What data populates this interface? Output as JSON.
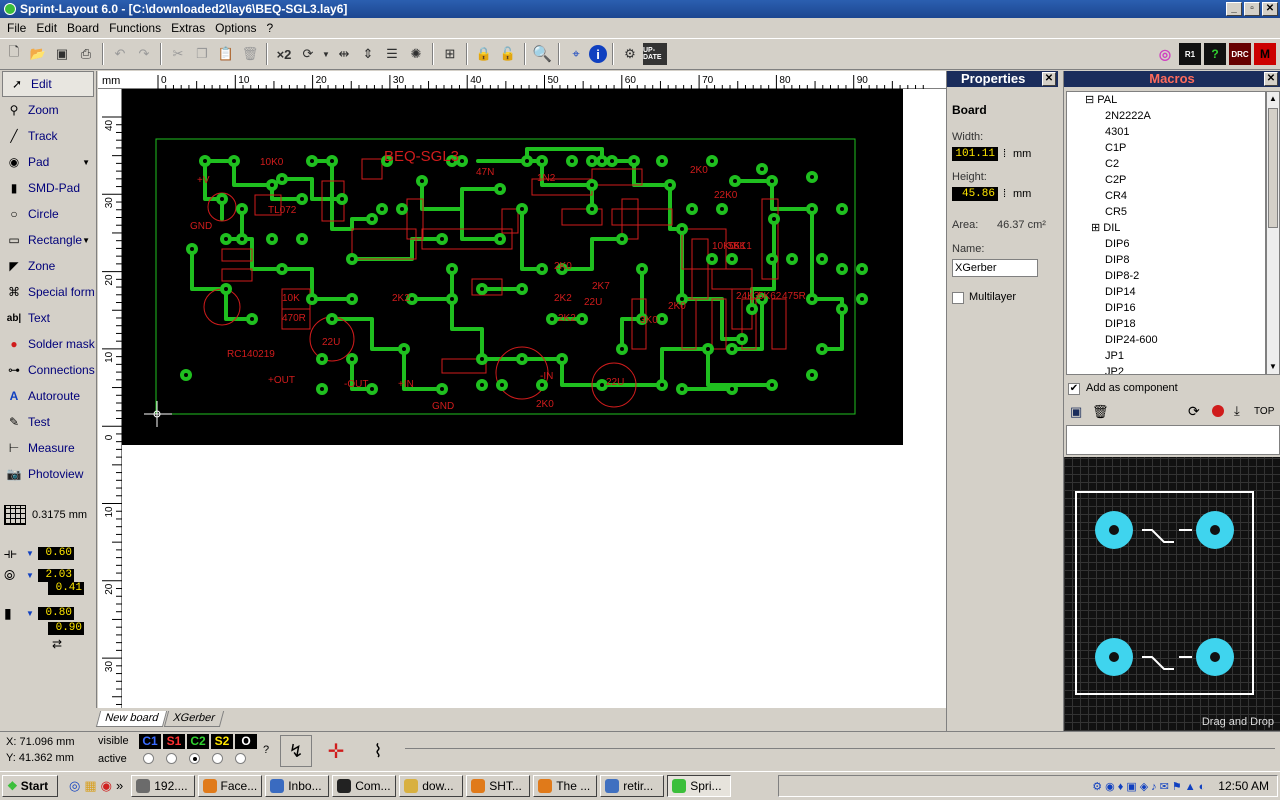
{
  "window": {
    "title": "Sprint-Layout 6.0 - [C:\\downloaded2\\lay6\\BEQ-SGL3.lay6]",
    "controls": [
      "_",
      "▫",
      "✕"
    ]
  },
  "menu": [
    "File",
    "Edit",
    "Board",
    "Functions",
    "Extras",
    "Options",
    "?"
  ],
  "toolbar": {
    "mult_label": "×2",
    "update_label": "UP-DATE",
    "right_icons": [
      "R1",
      "?",
      "DRC",
      "M"
    ]
  },
  "tools": [
    {
      "label": "Edit",
      "icon": "pointer-icon"
    },
    {
      "label": "Zoom",
      "icon": "magnifier-icon"
    },
    {
      "label": "Track",
      "icon": "track-icon"
    },
    {
      "label": "Pad",
      "icon": "pad-icon"
    },
    {
      "label": "SMD-Pad",
      "icon": "smd-pad-icon"
    },
    {
      "label": "Circle",
      "icon": "circle-icon"
    },
    {
      "label": "Rectangle",
      "icon": "rectangle-icon"
    },
    {
      "label": "Zone",
      "icon": "zone-icon"
    },
    {
      "label": "Special form",
      "icon": "special-form-icon"
    },
    {
      "label": "Text",
      "icon": "text-icon"
    },
    {
      "label": "Solder mask",
      "icon": "solder-mask-icon"
    },
    {
      "label": "Connections",
      "icon": "connections-icon"
    },
    {
      "label": "Autoroute",
      "icon": "autoroute-icon"
    },
    {
      "label": "Test",
      "icon": "test-icon"
    },
    {
      "label": "Measure",
      "icon": "measure-icon"
    },
    {
      "label": "Photoview",
      "icon": "photoview-icon"
    }
  ],
  "grid": {
    "value": "0.3175 mm"
  },
  "track_width": "0.60",
  "pad_outer": "2.03",
  "pad_inner": "0.41",
  "smd_w": "0.80",
  "smd_h": "0.90",
  "ruler": {
    "unit": "mm",
    "top_ticks": [
      "0",
      "10",
      "20",
      "30",
      "40",
      "50",
      "60",
      "70",
      "80",
      "90"
    ],
    "left_ticks": [
      "40",
      "30",
      "20",
      "10",
      "0",
      "10",
      "20",
      "30"
    ]
  },
  "board": {
    "silkscreen_texts": [
      "10K0",
      "TL072",
      "BEQ-SGL3",
      "47N",
      "1N2",
      "2K0",
      "22K0",
      "+V",
      "GND",
      "RC140219",
      "+OUT",
      "-OUT",
      "+IN",
      "GND",
      "-IN",
      "2K0",
      "10K",
      "470R",
      "22U",
      "22U",
      "2K2",
      "5K1",
      "24K3",
      "5K62",
      "475R",
      "10K0",
      "5K1",
      "2K0",
      "2K7",
      "2K2",
      "2K2",
      "3K0",
      "2K0",
      "22U"
    ]
  },
  "tabs": [
    "New board",
    "XGerber"
  ],
  "properties": {
    "title": "Properties",
    "section": "Board",
    "width_label": "Width:",
    "width_value": "101.11",
    "height_label": "Height:",
    "height_value": "45.86",
    "unit": "mm",
    "area_label": "Area:",
    "area_value": "46.37 cm²",
    "name_label": "Name:",
    "name_value": "XGerber",
    "multilayer_label": "Multilayer"
  },
  "macros": {
    "title": "Macros",
    "root": "PAL",
    "items": [
      "2N2222A",
      "4301",
      "C1P",
      "C2",
      "C2P",
      "CR4",
      "CR5",
      "DIL",
      "DIP6",
      "DIP8",
      "DIP8-2",
      "DIP14",
      "DIP16",
      "DIP18",
      "DIP24-600",
      "JP1",
      "JP2"
    ],
    "add_as_component": "Add as component",
    "top_label": "TOP",
    "drag_drop": "Drag and Drop"
  },
  "status": {
    "x_label": "X:",
    "x_value": "71.096 mm",
    "y_label": "Y:",
    "y_value": "41.362 mm",
    "visible_label": "visible",
    "active_label": "active",
    "layers": [
      {
        "name": "C1",
        "color": "#3a6cff"
      },
      {
        "name": "S1",
        "color": "#ff3030"
      },
      {
        "name": "C2",
        "color": "#30d030"
      },
      {
        "name": "S2",
        "color": "#ffe600"
      },
      {
        "name": "O",
        "color": "#ffffff"
      }
    ],
    "help": "?"
  },
  "taskbar": {
    "start": "Start",
    "tasks": [
      {
        "label": "192....",
        "color": "#6b6b6b"
      },
      {
        "label": "Face...",
        "color": "#e07a1a"
      },
      {
        "label": "Inbo...",
        "color": "#3a6bc0"
      },
      {
        "label": "Com...",
        "color": "#222222"
      },
      {
        "label": "dow...",
        "color": "#d8b040"
      },
      {
        "label": "SHT...",
        "color": "#e07a1a"
      },
      {
        "label": "The ...",
        "color": "#e07a1a"
      },
      {
        "label": "retir...",
        "color": "#4070c0"
      },
      {
        "label": "Spri...",
        "color": "#3bbf3b"
      }
    ],
    "clock": "12:50 AM"
  },
  "colors": {
    "copper": "#1fbf1f",
    "silk": "#d01c1c",
    "pad_preview": "#3fd4ee",
    "panel_header": "#1b2d5c"
  }
}
